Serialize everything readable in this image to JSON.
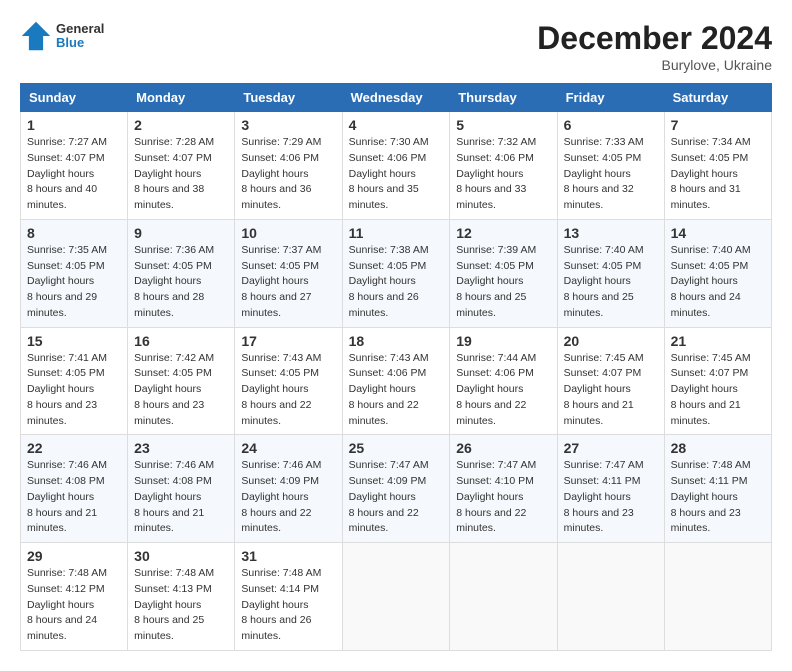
{
  "header": {
    "logo_line1": "General",
    "logo_line2": "Blue",
    "month_title": "December 2024",
    "subtitle": "Burylove, Ukraine"
  },
  "days_of_week": [
    "Sunday",
    "Monday",
    "Tuesday",
    "Wednesday",
    "Thursday",
    "Friday",
    "Saturday"
  ],
  "weeks": [
    [
      {
        "day": 1,
        "sunrise": "7:27 AM",
        "sunset": "4:07 PM",
        "daylight": "8 hours and 40 minutes."
      },
      {
        "day": 2,
        "sunrise": "7:28 AM",
        "sunset": "4:07 PM",
        "daylight": "8 hours and 38 minutes."
      },
      {
        "day": 3,
        "sunrise": "7:29 AM",
        "sunset": "4:06 PM",
        "daylight": "8 hours and 36 minutes."
      },
      {
        "day": 4,
        "sunrise": "7:30 AM",
        "sunset": "4:06 PM",
        "daylight": "8 hours and 35 minutes."
      },
      {
        "day": 5,
        "sunrise": "7:32 AM",
        "sunset": "4:06 PM",
        "daylight": "8 hours and 33 minutes."
      },
      {
        "day": 6,
        "sunrise": "7:33 AM",
        "sunset": "4:05 PM",
        "daylight": "8 hours and 32 minutes."
      },
      {
        "day": 7,
        "sunrise": "7:34 AM",
        "sunset": "4:05 PM",
        "daylight": "8 hours and 31 minutes."
      }
    ],
    [
      {
        "day": 8,
        "sunrise": "7:35 AM",
        "sunset": "4:05 PM",
        "daylight": "8 hours and 29 minutes."
      },
      {
        "day": 9,
        "sunrise": "7:36 AM",
        "sunset": "4:05 PM",
        "daylight": "8 hours and 28 minutes."
      },
      {
        "day": 10,
        "sunrise": "7:37 AM",
        "sunset": "4:05 PM",
        "daylight": "8 hours and 27 minutes."
      },
      {
        "day": 11,
        "sunrise": "7:38 AM",
        "sunset": "4:05 PM",
        "daylight": "8 hours and 26 minutes."
      },
      {
        "day": 12,
        "sunrise": "7:39 AM",
        "sunset": "4:05 PM",
        "daylight": "8 hours and 25 minutes."
      },
      {
        "day": 13,
        "sunrise": "7:40 AM",
        "sunset": "4:05 PM",
        "daylight": "8 hours and 25 minutes."
      },
      {
        "day": 14,
        "sunrise": "7:40 AM",
        "sunset": "4:05 PM",
        "daylight": "8 hours and 24 minutes."
      }
    ],
    [
      {
        "day": 15,
        "sunrise": "7:41 AM",
        "sunset": "4:05 PM",
        "daylight": "8 hours and 23 minutes."
      },
      {
        "day": 16,
        "sunrise": "7:42 AM",
        "sunset": "4:05 PM",
        "daylight": "8 hours and 23 minutes."
      },
      {
        "day": 17,
        "sunrise": "7:43 AM",
        "sunset": "4:05 PM",
        "daylight": "8 hours and 22 minutes."
      },
      {
        "day": 18,
        "sunrise": "7:43 AM",
        "sunset": "4:06 PM",
        "daylight": "8 hours and 22 minutes."
      },
      {
        "day": 19,
        "sunrise": "7:44 AM",
        "sunset": "4:06 PM",
        "daylight": "8 hours and 22 minutes."
      },
      {
        "day": 20,
        "sunrise": "7:45 AM",
        "sunset": "4:07 PM",
        "daylight": "8 hours and 21 minutes."
      },
      {
        "day": 21,
        "sunrise": "7:45 AM",
        "sunset": "4:07 PM",
        "daylight": "8 hours and 21 minutes."
      }
    ],
    [
      {
        "day": 22,
        "sunrise": "7:46 AM",
        "sunset": "4:08 PM",
        "daylight": "8 hours and 21 minutes."
      },
      {
        "day": 23,
        "sunrise": "7:46 AM",
        "sunset": "4:08 PM",
        "daylight": "8 hours and 21 minutes."
      },
      {
        "day": 24,
        "sunrise": "7:46 AM",
        "sunset": "4:09 PM",
        "daylight": "8 hours and 22 minutes."
      },
      {
        "day": 25,
        "sunrise": "7:47 AM",
        "sunset": "4:09 PM",
        "daylight": "8 hours and 22 minutes."
      },
      {
        "day": 26,
        "sunrise": "7:47 AM",
        "sunset": "4:10 PM",
        "daylight": "8 hours and 22 minutes."
      },
      {
        "day": 27,
        "sunrise": "7:47 AM",
        "sunset": "4:11 PM",
        "daylight": "8 hours and 23 minutes."
      },
      {
        "day": 28,
        "sunrise": "7:48 AM",
        "sunset": "4:11 PM",
        "daylight": "8 hours and 23 minutes."
      }
    ],
    [
      {
        "day": 29,
        "sunrise": "7:48 AM",
        "sunset": "4:12 PM",
        "daylight": "8 hours and 24 minutes."
      },
      {
        "day": 30,
        "sunrise": "7:48 AM",
        "sunset": "4:13 PM",
        "daylight": "8 hours and 25 minutes."
      },
      {
        "day": 31,
        "sunrise": "7:48 AM",
        "sunset": "4:14 PM",
        "daylight": "8 hours and 26 minutes."
      },
      null,
      null,
      null,
      null
    ]
  ]
}
